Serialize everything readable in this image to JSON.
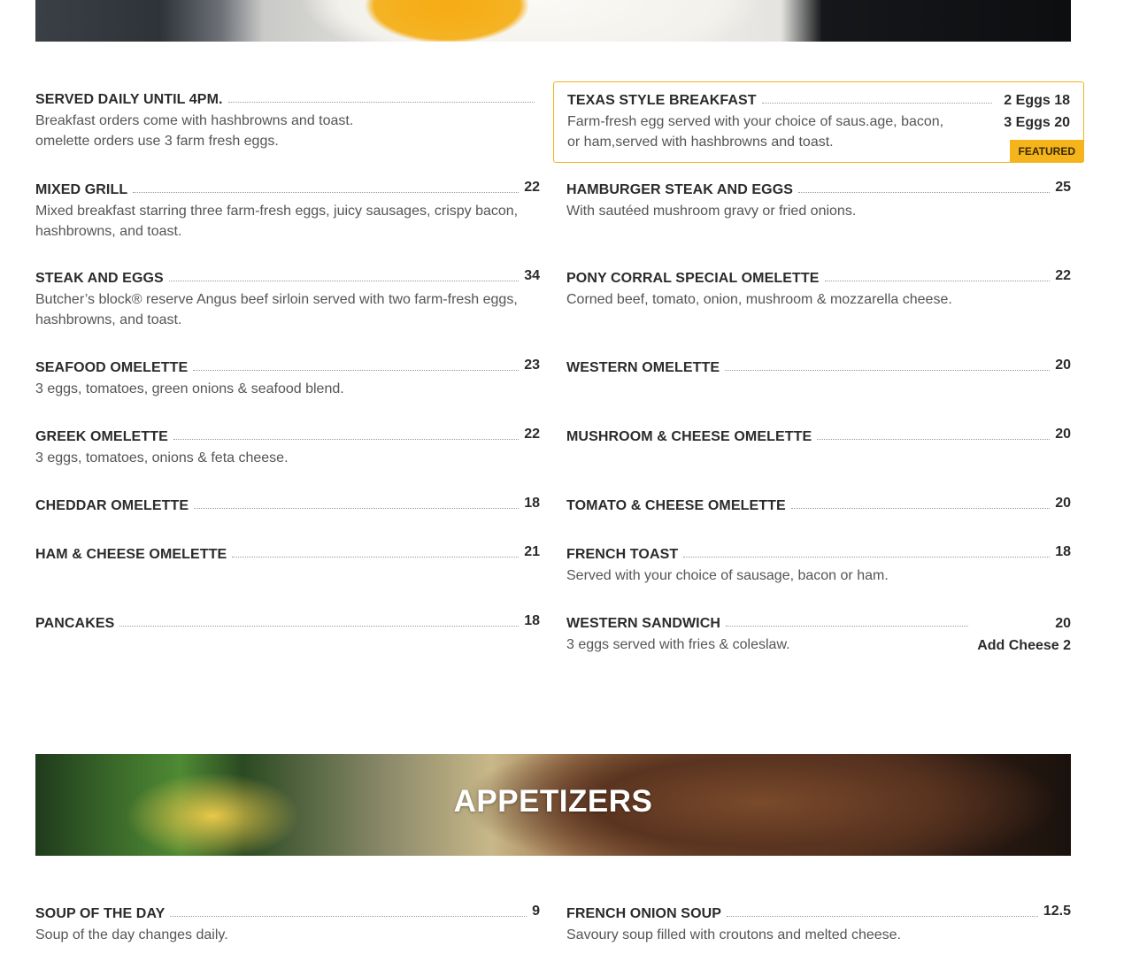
{
  "sections": {
    "appetizers_title": "APPETIZERS"
  },
  "breakfast": {
    "intro": {
      "name": "SERVED DAILY UNTIL 4PM.",
      "desc1": "Breakfast orders come with hashbrowns and toast.",
      "desc2": "omelette orders use 3 farm fresh eggs."
    },
    "texas": {
      "name": "TEXAS STYLE BREAKFAST",
      "price1": "2 Eggs 18",
      "price2": "3 Eggs 20",
      "desc1": "Farm-fresh egg served with your choice of saus.age, bacon,",
      "desc2": "or ham,served with hashbrowns and toast.",
      "badge": "FEATURED"
    },
    "mixed_grill": {
      "name": "MIXED GRILL",
      "price": "22",
      "desc1": "Mixed breakfast starring three farm-fresh eggs, juicy sausages, crispy bacon,",
      "desc2": "hashbrowns, and toast."
    },
    "hamburger_steak": {
      "name": "HAMBURGER STEAK AND EGGS",
      "price": "25",
      "desc1": "With sautéed mushroom gravy or fried onions."
    },
    "steak_eggs": {
      "name": "STEAK AND EGGS",
      "price": "34",
      "desc1": "Butcher’s block® reserve Angus beef sirloin served with two farm-fresh eggs,",
      "desc2": "hashbrowns, and toast."
    },
    "pony_corral": {
      "name": "PONY CORRAL SPECIAL OMELETTE",
      "price": "22",
      "desc1": "Corned beef, tomato, onion, mushroom & mozzarella cheese."
    },
    "seafood": {
      "name": "SEAFOOD OMELETTE",
      "price": "23",
      "desc1": "3 eggs, tomatoes, green onions & seafood blend."
    },
    "western_omelette": {
      "name": "WESTERN OMELETTE",
      "price": "20"
    },
    "greek": {
      "name": "GREEK OMELETTE",
      "price": "22",
      "desc1": "3 eggs, tomatoes, onions & feta cheese."
    },
    "mushroom_cheese": {
      "name": "MUSHROOM & CHEESE OMELETTE",
      "price": "20"
    },
    "cheddar": {
      "name": "CHEDDAR OMELETTE",
      "price": "18"
    },
    "tomato_cheese": {
      "name": "TOMATO & CHEESE OMELETTE",
      "price": "20"
    },
    "ham_cheese": {
      "name": "HAM & CHEESE OMELETTE",
      "price": "21"
    },
    "french_toast": {
      "name": "FRENCH TOAST",
      "price": "18",
      "desc1": "Served with your choice of sausage, bacon or ham."
    },
    "pancakes": {
      "name": "PANCAKES",
      "price": "18"
    },
    "western_sandwich": {
      "name": "WESTERN SANDWICH",
      "price": "20",
      "price2": "Add Cheese 2",
      "desc1": "3 eggs served with fries & coleslaw."
    }
  },
  "appetizers": {
    "soup_day": {
      "name": "SOUP OF THE DAY",
      "price": "9",
      "desc1": "Soup of the day changes daily."
    },
    "french_onion": {
      "name": "FRENCH ONION SOUP",
      "price": "12.5",
      "desc1": "Savoury soup filled with croutons and melted cheese."
    }
  }
}
